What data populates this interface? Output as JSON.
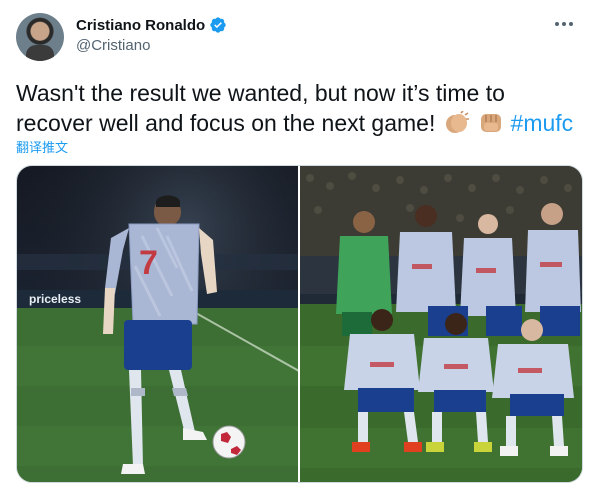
{
  "tweet": {
    "author": {
      "display_name": "Cristiano Ronaldo",
      "handle": "@Cristiano",
      "verified": true
    },
    "text_main": "Wasn't the result we wanted, but now it’s time to recover well and focus on the next game!",
    "emojis": [
      "clapping-hands-emoji",
      "fist-emoji"
    ],
    "hashtag": "#mufc",
    "translate_label": "翻译推文",
    "media": [
      {
        "name": "photo-ronaldo-corner",
        "shirt_number": "7"
      },
      {
        "name": "photo-team-lineup"
      }
    ],
    "brand": {
      "priceless": "priceless"
    }
  },
  "colors": {
    "accent": "#1d9bf0",
    "text": "#0f1419",
    "muted": "#536471"
  }
}
